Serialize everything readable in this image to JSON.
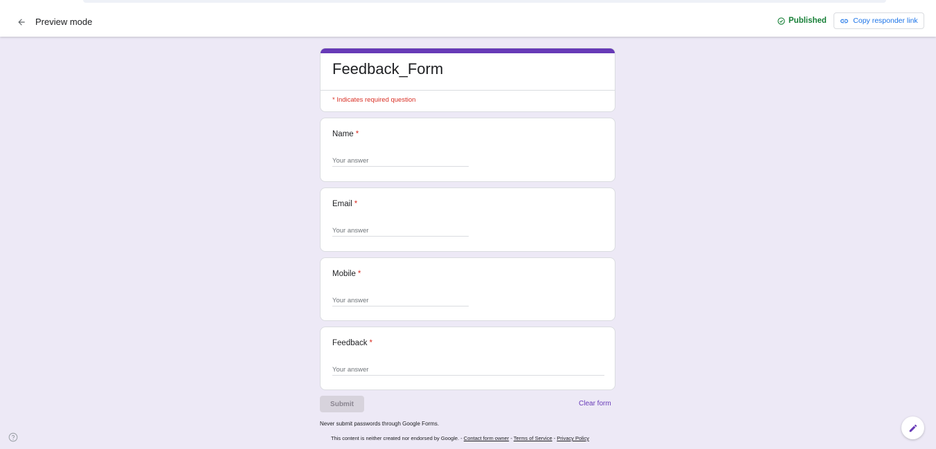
{
  "header": {
    "back_icon": "arrow-left-icon",
    "title": "Preview mode",
    "status": "Published",
    "status_color": "#188038",
    "copy_link_label": "Copy responder link",
    "accent_color": "#1a73e8"
  },
  "form": {
    "title": "Feedback_Form",
    "required_note": "* Indicates required question",
    "theme_color": "#673ab7",
    "questions": [
      {
        "label": "Name",
        "required": "*",
        "placeholder": "Your answer"
      },
      {
        "label": "Email",
        "required": "*",
        "placeholder": "Your answer"
      },
      {
        "label": "Mobile",
        "required": "*",
        "placeholder": "Your answer"
      },
      {
        "label": "Feedback",
        "required": "*",
        "placeholder": "Your answer"
      }
    ],
    "submit_label": "Submit",
    "clear_label": "Clear form"
  },
  "footer": {
    "warning": "Never submit passwords through Google Forms.",
    "disclaimer": "This content is neither created nor endorsed by Google. - ",
    "contact_link": "Contact form owner",
    "sep1": " - ",
    "terms_link": "Terms of Service",
    "sep2": " - ",
    "privacy_link": "Privacy Policy"
  },
  "icons": {
    "help": "help-circle-icon",
    "edit": "pencil-icon"
  }
}
